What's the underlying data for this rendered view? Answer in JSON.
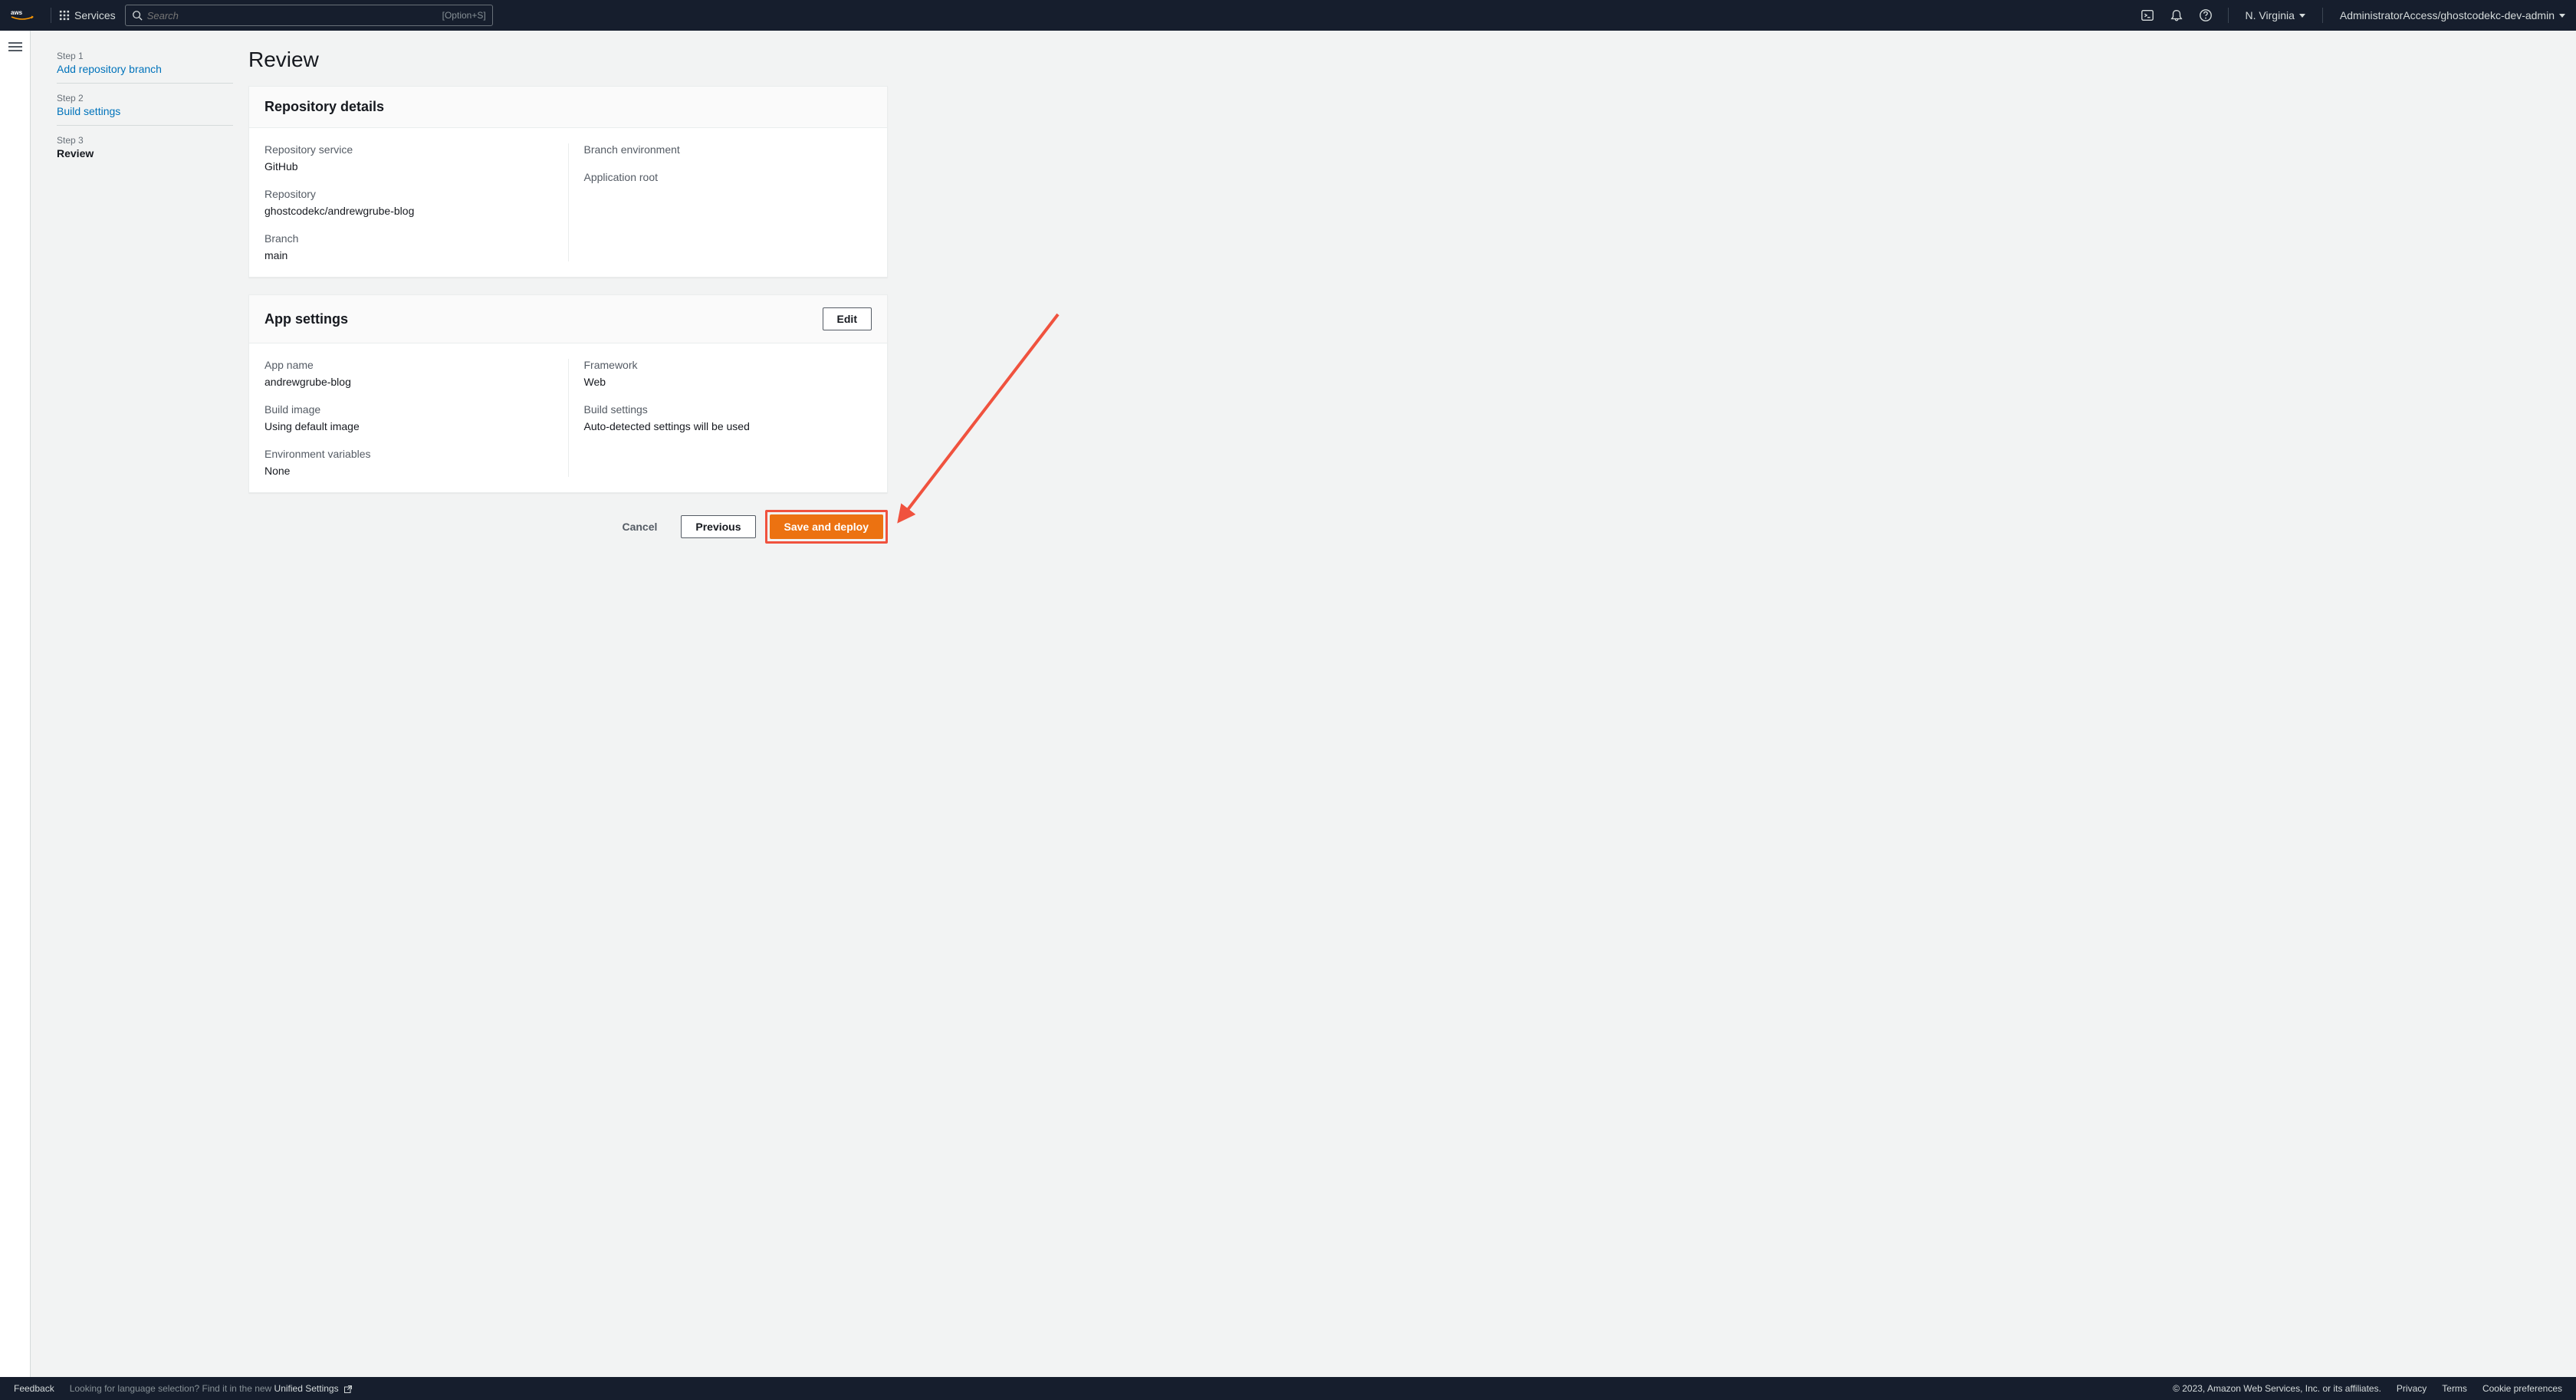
{
  "topnav": {
    "services_label": "Services",
    "search_placeholder": "Search",
    "search_kbd": "[Option+S]",
    "region": "N. Virginia",
    "account": "AdministratorAccess/ghostcodekc-dev-admin"
  },
  "steps": [
    {
      "num": "Step 1",
      "title": "Add repository branch",
      "link": true,
      "active": false
    },
    {
      "num": "Step 2",
      "title": "Build settings",
      "link": true,
      "active": false
    },
    {
      "num": "Step 3",
      "title": "Review",
      "link": false,
      "active": true
    }
  ],
  "page": {
    "title": "Review"
  },
  "repo_panel": {
    "title": "Repository details",
    "left": [
      {
        "label": "Repository service",
        "value": "GitHub"
      },
      {
        "label": "Repository",
        "value": "ghostcodekc/andrewgrube-blog"
      },
      {
        "label": "Branch",
        "value": "main"
      }
    ],
    "right": [
      {
        "label": "Branch environment",
        "value": ""
      },
      {
        "label": "Application root",
        "value": ""
      }
    ]
  },
  "app_panel": {
    "title": "App settings",
    "edit_label": "Edit",
    "left": [
      {
        "label": "App name",
        "value": "andrewgrube-blog"
      },
      {
        "label": "Build image",
        "value": "Using default image"
      },
      {
        "label": "Environment variables",
        "value": "None"
      }
    ],
    "right": [
      {
        "label": "Framework",
        "value": "Web"
      },
      {
        "label": "Build settings",
        "value": "Auto-detected settings will be used"
      }
    ]
  },
  "actions": {
    "cancel": "Cancel",
    "previous": "Previous",
    "save_deploy": "Save and deploy"
  },
  "footer": {
    "feedback": "Feedback",
    "lang_msg": "Looking for language selection? Find it in the new ",
    "unified": "Unified Settings",
    "copyright": "© 2023, Amazon Web Services, Inc. or its affiliates.",
    "privacy": "Privacy",
    "terms": "Terms",
    "cookie": "Cookie preferences"
  }
}
